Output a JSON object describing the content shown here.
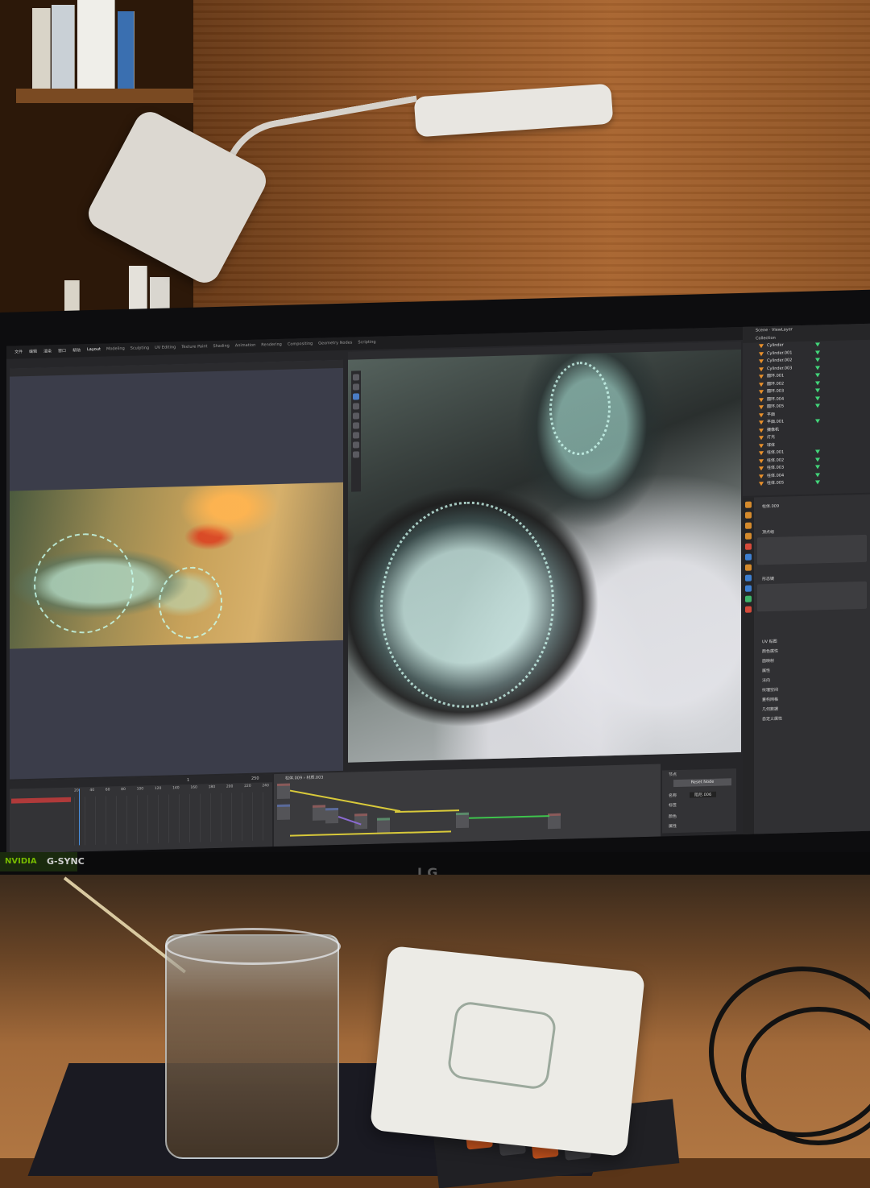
{
  "screen": {
    "app": "Blender",
    "menu": [
      "文件",
      "编辑",
      "渲染",
      "窗口",
      "帮助"
    ],
    "workspaces": [
      {
        "label": "Layout",
        "active": true
      },
      {
        "label": "Modeling",
        "active": false
      },
      {
        "label": "Sculpting",
        "active": false
      },
      {
        "label": "UV Editing",
        "active": false
      },
      {
        "label": "Texture Paint",
        "active": false
      },
      {
        "label": "Shading",
        "active": false
      },
      {
        "label": "Animation",
        "active": false
      },
      {
        "label": "Rendering",
        "active": false
      },
      {
        "label": "Compositing",
        "active": false
      },
      {
        "label": "Geometry Nodes",
        "active": false
      },
      {
        "label": "Scripting",
        "active": false
      }
    ],
    "outliner": {
      "scene": "Scene",
      "view_layer": "ViewLayer",
      "collection": "Collection",
      "items": [
        "Cylinder",
        "Cylinder.001",
        "Cylinder.002",
        "Cylinder.003",
        "圆环.001",
        "圆环.002",
        "圆环.003",
        "圆环.004",
        "圆环.005",
        "平面",
        "平面.001",
        "摄像机",
        "灯光",
        "球体",
        "柱体.001",
        "柱体.002",
        "柱体.003",
        "柱体.004",
        "柱体.005"
      ]
    },
    "properties": {
      "object_name": "柱体.009",
      "sections": [
        "顶点组",
        "形态键",
        "UV 贴图",
        "颜色属性",
        "面映射",
        "属性",
        "法向",
        "纹理空间",
        "重构网格",
        "几何数据",
        "自定义属性"
      ]
    },
    "timeline": {
      "ruler": [
        "20",
        "40",
        "60",
        "80",
        "100",
        "120",
        "140",
        "160",
        "180",
        "200",
        "220",
        "240"
      ],
      "current_frame": "1",
      "end_frame": "250"
    },
    "node_editor": {
      "breadcrumb": [
        "柱体.009",
        "材质.003"
      ],
      "material": "材质.003"
    },
    "node_panel": {
      "title": "节点",
      "reset_button": "Reset Node",
      "name_label": "名称",
      "name_value": "阻尼.006",
      "label_label": "标签",
      "color_label": "颜色",
      "props_label": "属性"
    }
  },
  "monitor": {
    "badge": "NVIDIA",
    "sync": "G-SYNC",
    "brand": "LG"
  },
  "colors": {
    "object_triangle": "#e8902b",
    "vertex_group": "#42d67a",
    "active_blue": "#4a90e2",
    "wire_yellow": "#d8c93a",
    "wire_green": "#3ec44d"
  }
}
